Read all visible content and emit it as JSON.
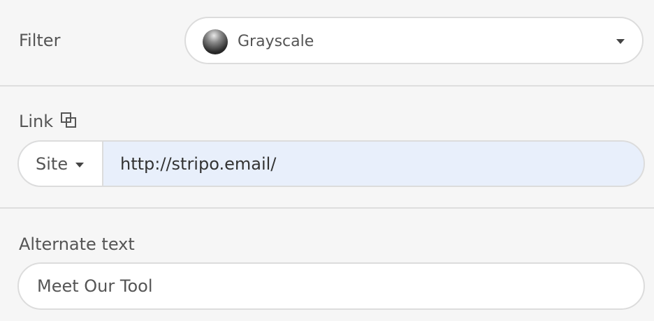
{
  "filter": {
    "label": "Filter",
    "selected": "Grayscale",
    "thumb_icon": "grayscale-preview-icon",
    "dropdown_icon": "caret-down-icon"
  },
  "link": {
    "label": "Link",
    "copy_icon": "link-copy-icon",
    "type_selector": "Site",
    "type_caret_icon": "caret-down-icon",
    "url": "http://stripo.email/"
  },
  "alt_text": {
    "label": "Alternate text",
    "value": "Meet Our Tool"
  },
  "colors": {
    "panel_background": "#f6f6f6",
    "input_background": "#ffffff",
    "link_input_background": "#e8effb",
    "border": "#dcdcdc",
    "text": "#555555"
  }
}
